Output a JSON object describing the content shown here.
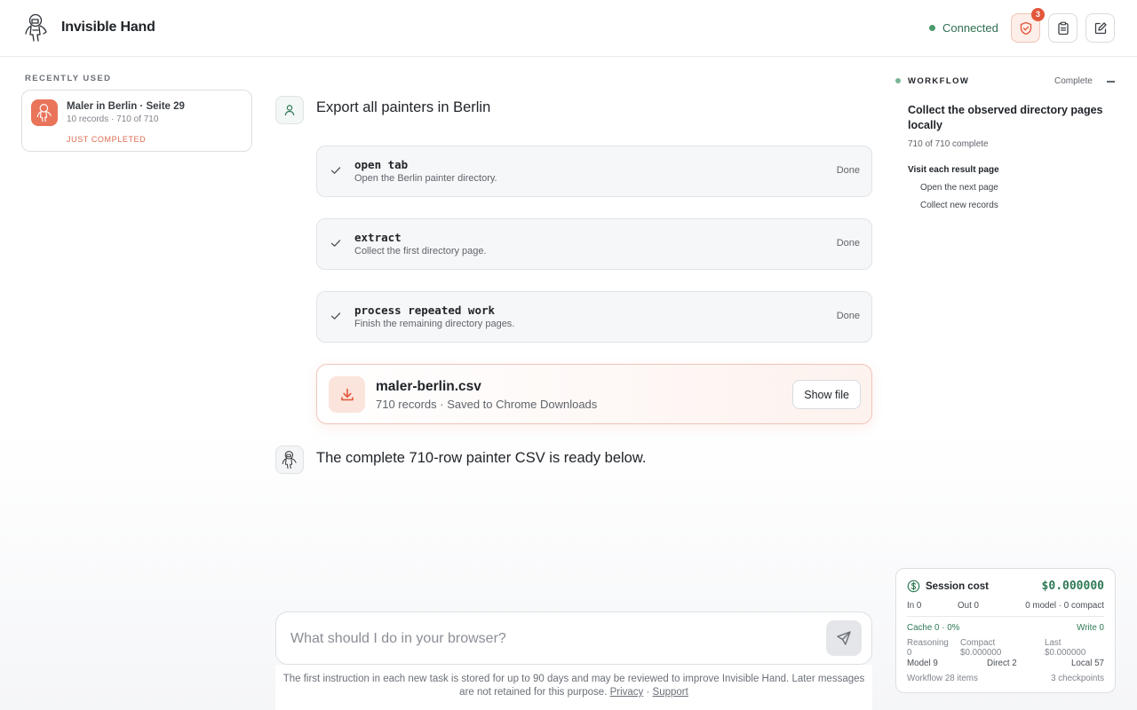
{
  "header": {
    "brand_name": "Invisible Hand",
    "connection_status": "Connected",
    "shield_badge_count": "3",
    "status_color": "#4a9a6e",
    "accent_color": "#e2573b"
  },
  "sidebar": {
    "section_title": "RECENTLY USED",
    "recent": {
      "name": "Maler in Berlin · Seite 29",
      "subtitle": "10 records · 710 of 710",
      "status": "JUST COMPLETED"
    }
  },
  "chat": {
    "user_message": "Export all painters in Berlin",
    "steps": [
      {
        "title": "open tab",
        "description": "Open the Berlin painter directory.",
        "state": "Done"
      },
      {
        "title": "extract",
        "description": "Collect the first directory page.",
        "state": "Done"
      },
      {
        "title": "process repeated work",
        "description": "Finish the remaining directory pages.",
        "state": "Done"
      }
    ],
    "file": {
      "name": "maler-berlin.csv",
      "subtitle": "710 records · Saved to Chrome Downloads",
      "button_label": "Show file"
    },
    "assistant_message": "The complete 710-row painter CSV is ready below."
  },
  "composer": {
    "placeholder": "What should I do in your browser?",
    "value": "",
    "footnote": "The first instruction in each new task is stored for up to 90 days and may be reviewed to improve Invisible Hand. Later messages are not retained for this purpose.",
    "privacy_label": "Privacy",
    "separator": " · ",
    "support_label": "Support"
  },
  "workflow": {
    "title": "WORKFLOW",
    "status": "Complete",
    "goal": "Collect the observed directory pages locally",
    "progress": "710 of 710 complete",
    "step": "Visit each result page",
    "substeps": [
      "Open the next page",
      "Collect new records"
    ]
  },
  "session_cost": {
    "title": "Session cost",
    "total": "$0.000000",
    "in": "In 0",
    "out": "Out 0",
    "model_compact": "0 model · 0 compact",
    "cache": "Cache 0 · 0%",
    "write": "Write 0",
    "reasoning_label": "Reasoning",
    "reasoning_value": "0",
    "compact_label": "Compact",
    "compact_value": "$0.000000",
    "last_label": "Last",
    "last_value": "$0.000000",
    "model": "Model 9",
    "direct": "Direct 2",
    "local": "Local 57",
    "workflow_items": "Workflow 28 items",
    "checkpoints": "3 checkpoints"
  }
}
